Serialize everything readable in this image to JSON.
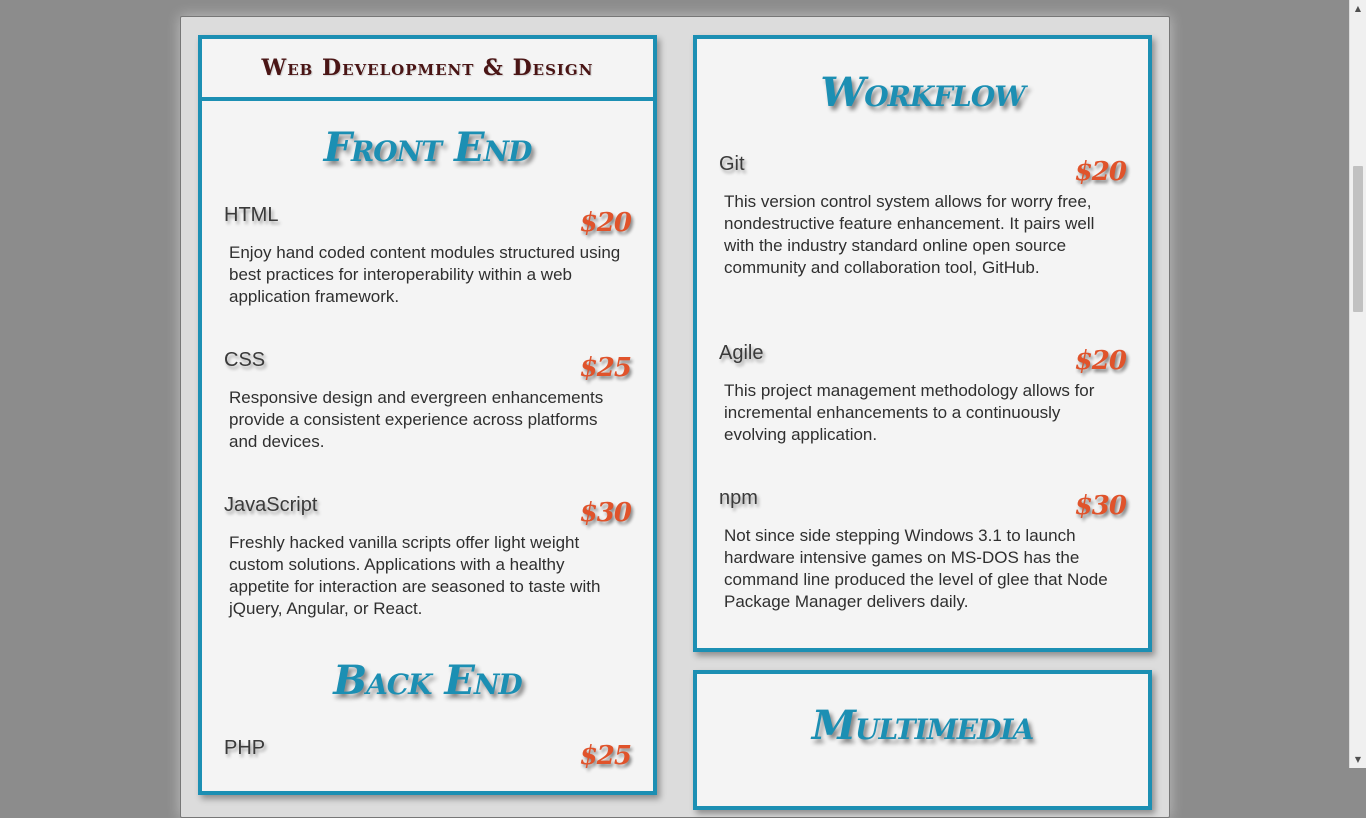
{
  "menu": {
    "title": "Web Development & Design"
  },
  "front_end": {
    "title": "Front End",
    "items": [
      {
        "name": "HTML",
        "price": "$20",
        "description": "Enjoy hand coded content modules structured using best practices for interoperability within a web application framework."
      },
      {
        "name": "CSS",
        "price": "$25",
        "description": "Responsive design and evergreen enhancements provide a consistent experience across platforms and devices."
      },
      {
        "name": "JavaScript",
        "price": "$30",
        "description": "Freshly hacked vanilla scripts offer light weight custom solutions. Applications with a healthy appetite for interaction are seasoned to taste with jQuery, Angular, or React."
      }
    ]
  },
  "back_end": {
    "title": "Back End",
    "items": [
      {
        "name": "PHP",
        "price": "$25"
      }
    ]
  },
  "workflow": {
    "title": "Workflow",
    "items": [
      {
        "name": "Git",
        "price": "$20",
        "description": "This version control system allows for worry free, nondestructive feature enhancement. It pairs well with the industry standard online open source community and collaboration tool, GitHub."
      },
      {
        "name": "Agile",
        "price": "$20",
        "description": "This project management methodology allows for incremental enhancements to a continuously evolving application."
      },
      {
        "name": "npm",
        "price": "$30",
        "description": "Not since side stepping Windows 3.1 to launch hardware intensive games on MS-DOS has the command line produced the level of glee that Node Package Manager delivers daily."
      }
    ]
  },
  "multimedia": {
    "title": "Multimedia"
  },
  "colors": {
    "accent": "#1c8fb3",
    "price": "#e0532b",
    "title": "#4a1515",
    "background": "#8c8c8c"
  },
  "scrollbar": {
    "up_icon": "triangle-up",
    "down_icon": "triangle-down"
  }
}
